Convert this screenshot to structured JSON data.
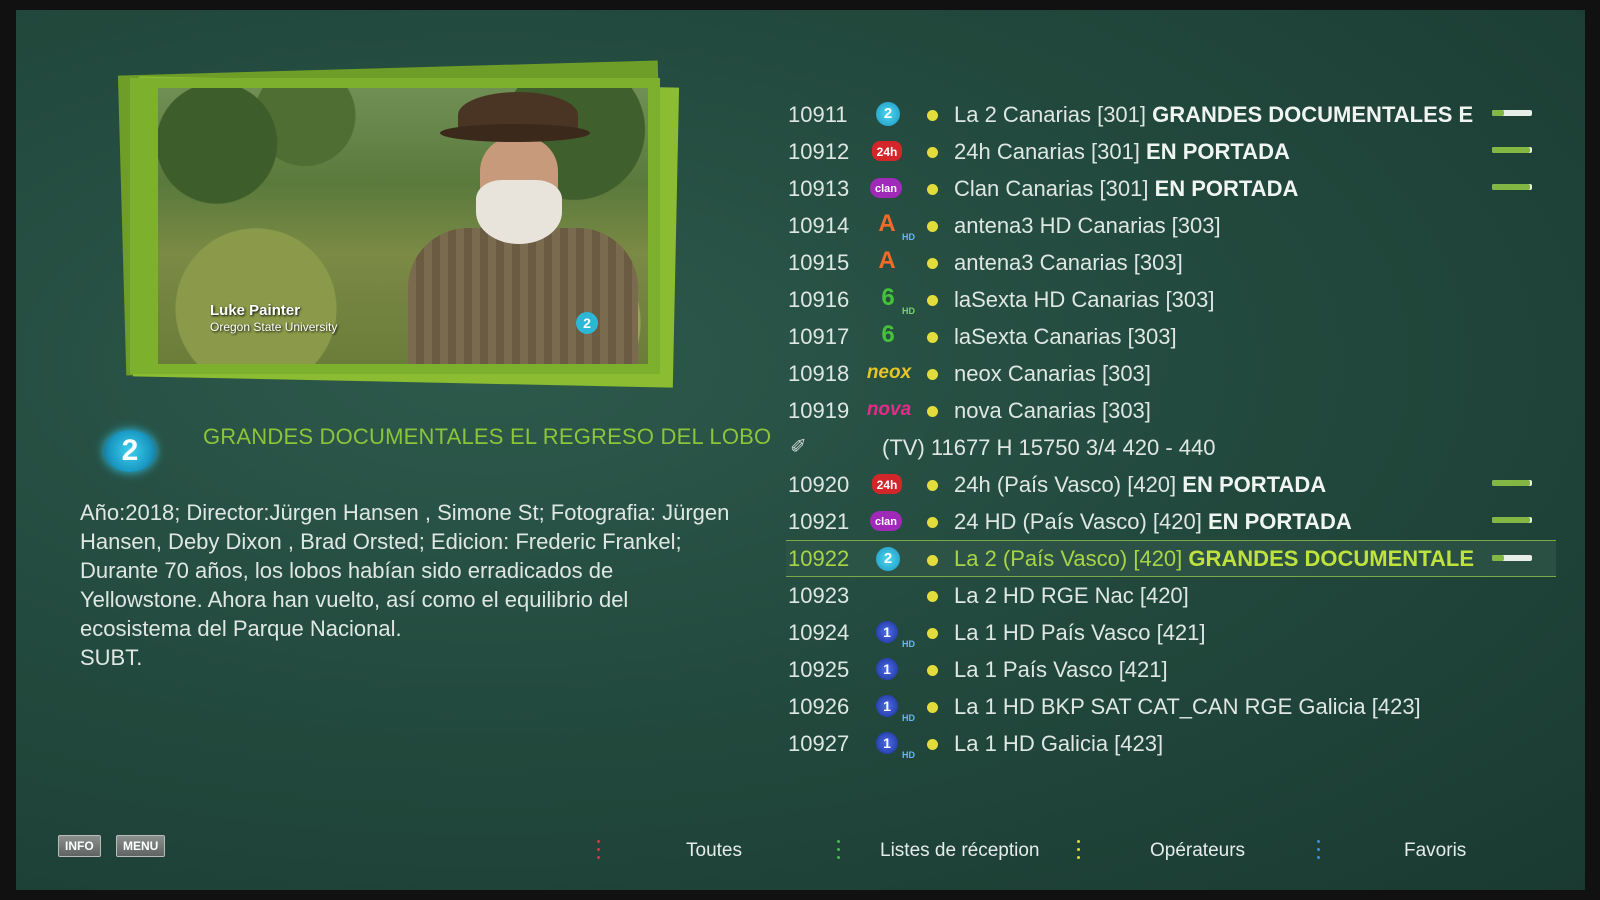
{
  "preview": {
    "lower_third_name": "Luke Painter",
    "lower_third_org": "Oregon State University",
    "bug": "2"
  },
  "program": {
    "channel_logo": "2",
    "title": "GRANDES DOCUMENTALES EL REGRESO DEL LOBO",
    "description": "Año:2018; Director:Jürgen Hansen , Simone St; Fotografia: Jürgen\nHansen, Deby Dixon , Brad Orsted; Edicion: Frederic Frankel;\nDurante 70 años, los lobos habían sido erradicados de\nYellowstone. Ahora han vuelto, así como el equilibrio del\necosistema del Parque Nacional.\nSUBT."
  },
  "channels_a": [
    {
      "num": "10911",
      "logo": "2",
      "name": "La 2 Canarias [301]",
      "event": "GRANDES DOCUMENTALES EL",
      "progress": 0.3
    },
    {
      "num": "10912",
      "logo": "24h",
      "name": "24h Canarias [301]",
      "event": "EN PORTADA",
      "progress": 0.95
    },
    {
      "num": "10913",
      "logo": "clan",
      "name": "Clan Canarias [301]",
      "event": "EN PORTADA",
      "progress": 0.95
    },
    {
      "num": "10914",
      "logo": "A",
      "name": "antena3 HD Canarias [303]",
      "event": ""
    },
    {
      "num": "10915",
      "logo": "A",
      "name": "antena3 Canarias [303]",
      "event": ""
    },
    {
      "num": "10916",
      "logo": "6",
      "name": "laSexta HD Canarias [303]",
      "event": ""
    },
    {
      "num": "10917",
      "logo": "6",
      "name": "laSexta Canarias [303]",
      "event": ""
    },
    {
      "num": "10918",
      "logo": "neox",
      "name": "neox Canarias [303]",
      "event": ""
    },
    {
      "num": "10919",
      "logo": "nova",
      "name": "nova Canarias [303]",
      "event": ""
    }
  ],
  "transponder": "(TV) 11677 H 15750 3/4  420 - 440",
  "channels_b": [
    {
      "num": "10920",
      "logo": "24h",
      "name": "24h (País Vasco) [420]",
      "event": "EN PORTADA",
      "progress": 0.95
    },
    {
      "num": "10921",
      "logo": "clan",
      "name": "24 HD (País Vasco) [420]",
      "event": "EN PORTADA",
      "progress": 0.95
    },
    {
      "num": "10922",
      "logo": "2",
      "name": "La 2 (País Vasco) [420]",
      "event": "GRANDES DOCUMENTALES",
      "progress": 0.3
    },
    {
      "num": "10923",
      "logo": "",
      "name": "La 2 HD RGE Nac [420]",
      "event": ""
    },
    {
      "num": "10924",
      "logo": "1",
      "name": "La 1 HD País Vasco [421]",
      "event": ""
    },
    {
      "num": "10925",
      "logo": "1",
      "name": "La 1 País Vasco [421]",
      "event": ""
    },
    {
      "num": "10926",
      "logo": "1",
      "name": "La 1 HD BKP SAT CAT_CAN RGE Galicia [423]",
      "event": ""
    },
    {
      "num": "10927",
      "logo": "1",
      "name": "La 1 HD Galicia [423]",
      "event": ""
    }
  ],
  "hd_label": "HD",
  "footer": {
    "info": "INFO",
    "menu": "MENU",
    "tabs": [
      "Toutes",
      "Listes de réception",
      "Opérateurs",
      "Favoris"
    ],
    "tab_dot_colors": [
      "#d83a3a",
      "#3fbf4a",
      "#e3d63a",
      "#3a8fe0"
    ]
  },
  "colors": {
    "accent_green": "#8cc43a",
    "status_dot": "#e2dc3c"
  }
}
